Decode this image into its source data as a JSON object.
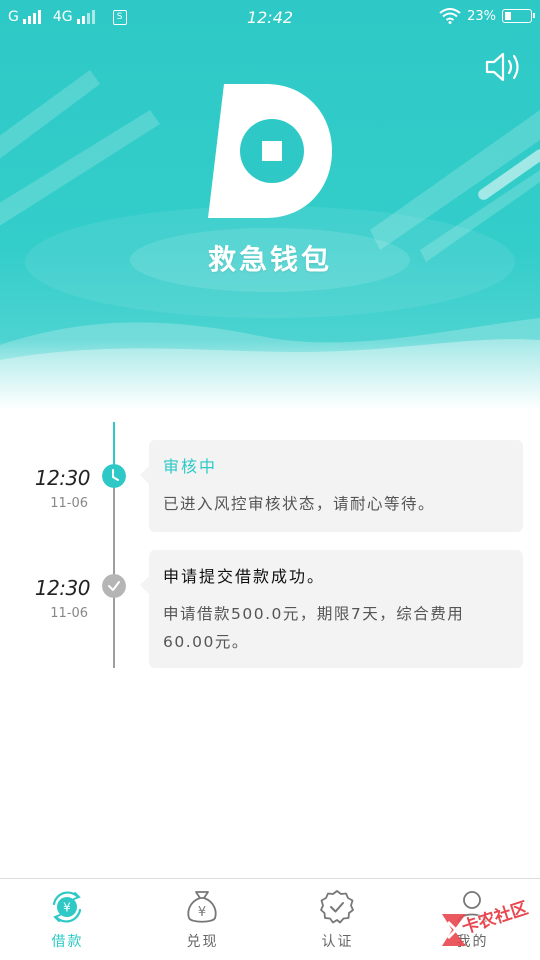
{
  "status_bar": {
    "carrier1": "G",
    "carrier2": "4G",
    "sim_label": "S",
    "time": "12:42",
    "battery_text": "23%",
    "battery_level": 0.23
  },
  "header": {
    "app_name": "救急钱包"
  },
  "timeline": [
    {
      "time": "12:30",
      "date": "11-06",
      "title": "审核中",
      "body": "已进入风控审核状态，请耐心等待。",
      "state": "current"
    },
    {
      "time": "12:30",
      "date": "11-06",
      "title": "申请提交借款成功。",
      "body": "申请借款500.0元，期限7天，综合费用60.00元。",
      "state": "done"
    }
  ],
  "tabs": [
    {
      "label": "借款",
      "icon": "loan-icon",
      "active": true
    },
    {
      "label": "兑现",
      "icon": "money-bag-icon",
      "active": false
    },
    {
      "label": "认证",
      "icon": "badge-check-icon",
      "active": false
    },
    {
      "label": "我的",
      "icon": "user-icon",
      "active": false
    }
  ],
  "watermark": {
    "text": "卡农社区"
  },
  "colors": {
    "accent": "#2ec9c6",
    "done_gray": "#b5b5b5",
    "card_bg": "#f3f3f3"
  }
}
